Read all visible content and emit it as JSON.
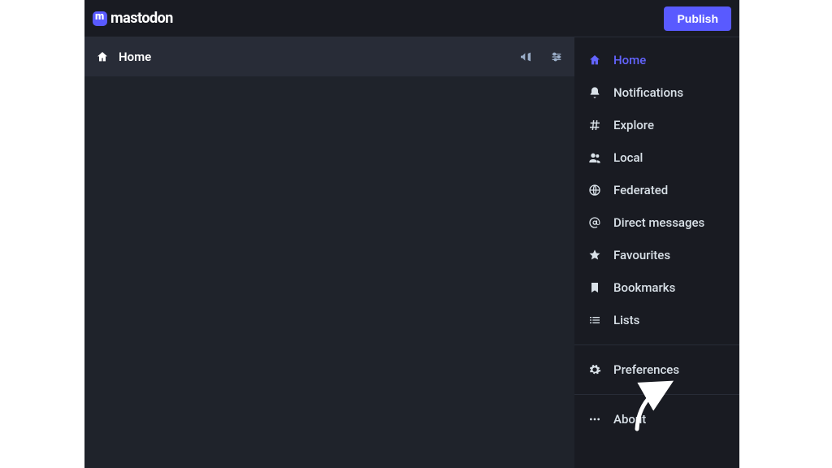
{
  "brand": "mastodon",
  "topbar": {
    "publish_label": "Publish"
  },
  "column": {
    "title": "Home"
  },
  "sidebar": {
    "items": [
      {
        "label": "Home",
        "icon": "home-icon",
        "active": true
      },
      {
        "label": "Notifications",
        "icon": "bell-icon",
        "active": false
      },
      {
        "label": "Explore",
        "icon": "hash-icon",
        "active": false
      },
      {
        "label": "Local",
        "icon": "users-icon",
        "active": false
      },
      {
        "label": "Federated",
        "icon": "globe-icon",
        "active": false
      },
      {
        "label": "Direct messages",
        "icon": "at-icon",
        "active": false
      },
      {
        "label": "Favourites",
        "icon": "star-icon",
        "active": false
      },
      {
        "label": "Bookmarks",
        "icon": "bookmark-icon",
        "active": false
      },
      {
        "label": "Lists",
        "icon": "list-icon",
        "active": false
      }
    ],
    "secondary": [
      {
        "label": "Preferences",
        "icon": "gear-icon"
      }
    ],
    "tertiary": [
      {
        "label": "About",
        "icon": "dots-icon"
      }
    ]
  }
}
